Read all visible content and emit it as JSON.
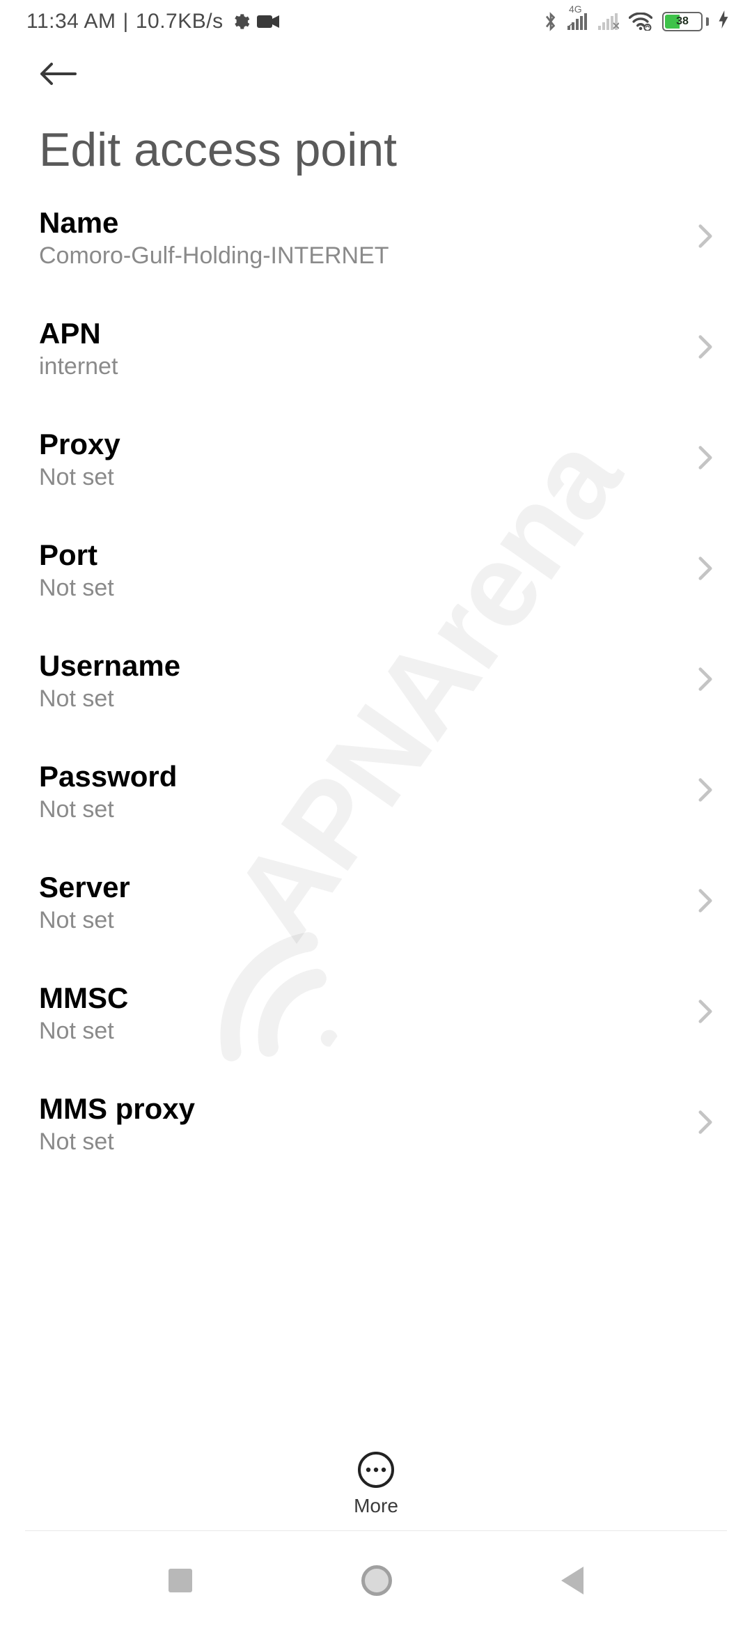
{
  "status": {
    "time": "11:34 AM",
    "speed": "10.7KB/s",
    "network_label_small": "4G",
    "battery_pct": "38"
  },
  "header": {
    "title": "Edit access point"
  },
  "items": [
    {
      "label": "Name",
      "value": "Comoro-Gulf-Holding-INTERNET"
    },
    {
      "label": "APN",
      "value": "internet"
    },
    {
      "label": "Proxy",
      "value": "Not set"
    },
    {
      "label": "Port",
      "value": "Not set"
    },
    {
      "label": "Username",
      "value": "Not set"
    },
    {
      "label": "Password",
      "value": "Not set"
    },
    {
      "label": "Server",
      "value": "Not set"
    },
    {
      "label": "MMSC",
      "value": "Not set"
    },
    {
      "label": "MMS proxy",
      "value": "Not set"
    }
  ],
  "bottom": {
    "more_label": "More"
  },
  "watermark_text": "APNArena"
}
